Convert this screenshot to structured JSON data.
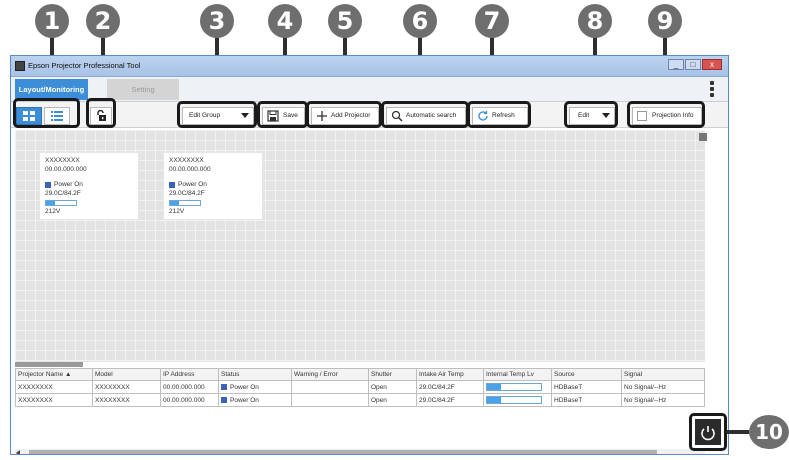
{
  "callouts": [
    "1",
    "2",
    "3",
    "4",
    "5",
    "6",
    "7",
    "8",
    "9",
    "10"
  ],
  "window": {
    "title": "Epson Projector Professional Tool",
    "controls": [
      "_",
      "□",
      "x"
    ]
  },
  "tabs": [
    {
      "label": "Layout/Monitoring"
    },
    {
      "label": "Setting"
    }
  ],
  "toolbar": {
    "edit_group": "Edit Group",
    "save": "Save",
    "add_projector": "Add Projector",
    "automatic_search": "Automatic search",
    "refresh": "Refresh",
    "edit": "Edit",
    "projection_info": "Projection Info"
  },
  "cards": [
    {
      "name": "XXXXXXXX",
      "ip": "00.00.000.000",
      "status": "Power On",
      "temp": "29.0C/84.2F",
      "voltage": "212V",
      "level": 0.3
    },
    {
      "name": "XXXXXXXX",
      "ip": "00.00.000.000",
      "status": "Power On",
      "temp": "29.0C/84.2F",
      "voltage": "212V",
      "level": 0.3
    }
  ],
  "table": {
    "headers": [
      "Projector Name ▲",
      "Model",
      "IP Address",
      "Status",
      "Warning / Error",
      "Shutter",
      "Intake Air Temp",
      "Internal Temp Lv",
      "Source",
      "Signal"
    ],
    "rows": [
      {
        "name": "XXXXXXXX",
        "model": "XXXXXXXX",
        "ip": "00.00.000.000",
        "status": "Power On",
        "warning": "",
        "shutter": "Open",
        "intake": "29.0C/84.2F",
        "internal_level": 0.25,
        "source": "HDBaseT",
        "signal": "No Signal/--Hz"
      },
      {
        "name": "XXXXXXXX",
        "model": "XXXXXXXX",
        "ip": "00.00.000.000",
        "status": "Power On",
        "warning": "",
        "shutter": "Open",
        "intake": "29.0C/84.2F",
        "internal_level": 0.25,
        "source": "HDBaseT",
        "signal": "No Signal/--Hz"
      }
    ]
  },
  "colors": {
    "accent": "#3d8ed9",
    "status_on": "#3a62b8",
    "level": "#4aa3e6"
  }
}
